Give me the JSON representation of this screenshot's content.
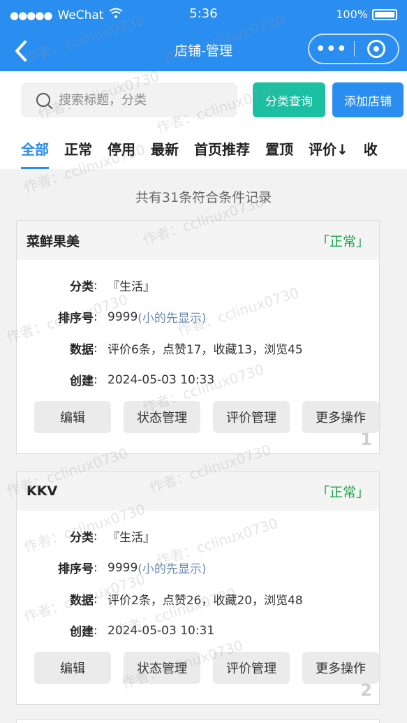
{
  "status_bar": {
    "carrier": "WeChat",
    "time": "5:36",
    "battery": "100%"
  },
  "nav": {
    "title": "店铺-管理"
  },
  "search": {
    "placeholder": "搜索标题，分类",
    "category_btn": "分类查询",
    "add_btn": "添加店铺"
  },
  "tabs": [
    "全部",
    "正常",
    "停用",
    "最新",
    "首页推荐",
    "置顶",
    "评价↓",
    "收"
  ],
  "count_text": "共有31条符合条件记录",
  "labels": {
    "category": "分类",
    "sort": "排序号",
    "data": "数据",
    "created": "创建",
    "colon": ":"
  },
  "actions": [
    "编辑",
    "状态管理",
    "评价管理",
    "更多操作"
  ],
  "cards": [
    {
      "name": "菜鲜果美",
      "status": "「正常」",
      "category": "『生活』",
      "sort": "9999",
      "sort_hint": "(小的先显示)",
      "data": "评价6条，点赞17，收藏13，浏览45",
      "created": "2024-05-03 10:33",
      "index": "1"
    },
    {
      "name": "KKV",
      "status": "「正常」",
      "category": "『生活』",
      "sort": "9999",
      "sort_hint": "(小的先显示)",
      "data": "评价2条，点赞26，收藏20，浏览48",
      "created": "2024-05-03 10:31",
      "index": "2"
    }
  ],
  "watermark": "作者：cclinux0730",
  "colors": {
    "primary": "#2a8df0",
    "teal": "#1dbfa3",
    "status_green": "#1aa34a"
  }
}
